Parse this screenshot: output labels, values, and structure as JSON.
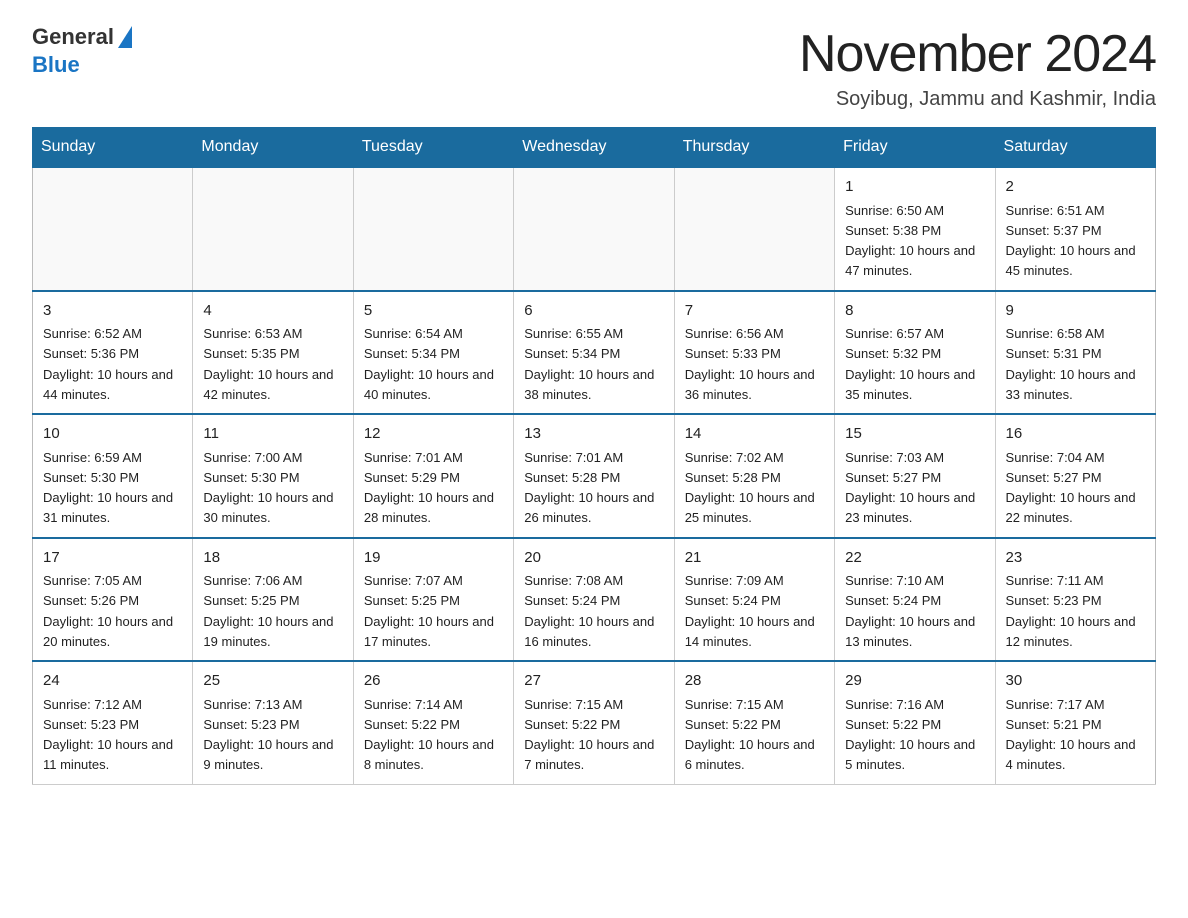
{
  "logo": {
    "general": "General",
    "blue": "Blue"
  },
  "header": {
    "month_year": "November 2024",
    "location": "Soyibug, Jammu and Kashmir, India"
  },
  "weekdays": [
    "Sunday",
    "Monday",
    "Tuesday",
    "Wednesday",
    "Thursday",
    "Friday",
    "Saturday"
  ],
  "weeks": [
    [
      {
        "day": "",
        "info": ""
      },
      {
        "day": "",
        "info": ""
      },
      {
        "day": "",
        "info": ""
      },
      {
        "day": "",
        "info": ""
      },
      {
        "day": "",
        "info": ""
      },
      {
        "day": "1",
        "info": "Sunrise: 6:50 AM\nSunset: 5:38 PM\nDaylight: 10 hours and 47 minutes."
      },
      {
        "day": "2",
        "info": "Sunrise: 6:51 AM\nSunset: 5:37 PM\nDaylight: 10 hours and 45 minutes."
      }
    ],
    [
      {
        "day": "3",
        "info": "Sunrise: 6:52 AM\nSunset: 5:36 PM\nDaylight: 10 hours and 44 minutes."
      },
      {
        "day": "4",
        "info": "Sunrise: 6:53 AM\nSunset: 5:35 PM\nDaylight: 10 hours and 42 minutes."
      },
      {
        "day": "5",
        "info": "Sunrise: 6:54 AM\nSunset: 5:34 PM\nDaylight: 10 hours and 40 minutes."
      },
      {
        "day": "6",
        "info": "Sunrise: 6:55 AM\nSunset: 5:34 PM\nDaylight: 10 hours and 38 minutes."
      },
      {
        "day": "7",
        "info": "Sunrise: 6:56 AM\nSunset: 5:33 PM\nDaylight: 10 hours and 36 minutes."
      },
      {
        "day": "8",
        "info": "Sunrise: 6:57 AM\nSunset: 5:32 PM\nDaylight: 10 hours and 35 minutes."
      },
      {
        "day": "9",
        "info": "Sunrise: 6:58 AM\nSunset: 5:31 PM\nDaylight: 10 hours and 33 minutes."
      }
    ],
    [
      {
        "day": "10",
        "info": "Sunrise: 6:59 AM\nSunset: 5:30 PM\nDaylight: 10 hours and 31 minutes."
      },
      {
        "day": "11",
        "info": "Sunrise: 7:00 AM\nSunset: 5:30 PM\nDaylight: 10 hours and 30 minutes."
      },
      {
        "day": "12",
        "info": "Sunrise: 7:01 AM\nSunset: 5:29 PM\nDaylight: 10 hours and 28 minutes."
      },
      {
        "day": "13",
        "info": "Sunrise: 7:01 AM\nSunset: 5:28 PM\nDaylight: 10 hours and 26 minutes."
      },
      {
        "day": "14",
        "info": "Sunrise: 7:02 AM\nSunset: 5:28 PM\nDaylight: 10 hours and 25 minutes."
      },
      {
        "day": "15",
        "info": "Sunrise: 7:03 AM\nSunset: 5:27 PM\nDaylight: 10 hours and 23 minutes."
      },
      {
        "day": "16",
        "info": "Sunrise: 7:04 AM\nSunset: 5:27 PM\nDaylight: 10 hours and 22 minutes."
      }
    ],
    [
      {
        "day": "17",
        "info": "Sunrise: 7:05 AM\nSunset: 5:26 PM\nDaylight: 10 hours and 20 minutes."
      },
      {
        "day": "18",
        "info": "Sunrise: 7:06 AM\nSunset: 5:25 PM\nDaylight: 10 hours and 19 minutes."
      },
      {
        "day": "19",
        "info": "Sunrise: 7:07 AM\nSunset: 5:25 PM\nDaylight: 10 hours and 17 minutes."
      },
      {
        "day": "20",
        "info": "Sunrise: 7:08 AM\nSunset: 5:24 PM\nDaylight: 10 hours and 16 minutes."
      },
      {
        "day": "21",
        "info": "Sunrise: 7:09 AM\nSunset: 5:24 PM\nDaylight: 10 hours and 14 minutes."
      },
      {
        "day": "22",
        "info": "Sunrise: 7:10 AM\nSunset: 5:24 PM\nDaylight: 10 hours and 13 minutes."
      },
      {
        "day": "23",
        "info": "Sunrise: 7:11 AM\nSunset: 5:23 PM\nDaylight: 10 hours and 12 minutes."
      }
    ],
    [
      {
        "day": "24",
        "info": "Sunrise: 7:12 AM\nSunset: 5:23 PM\nDaylight: 10 hours and 11 minutes."
      },
      {
        "day": "25",
        "info": "Sunrise: 7:13 AM\nSunset: 5:23 PM\nDaylight: 10 hours and 9 minutes."
      },
      {
        "day": "26",
        "info": "Sunrise: 7:14 AM\nSunset: 5:22 PM\nDaylight: 10 hours and 8 minutes."
      },
      {
        "day": "27",
        "info": "Sunrise: 7:15 AM\nSunset: 5:22 PM\nDaylight: 10 hours and 7 minutes."
      },
      {
        "day": "28",
        "info": "Sunrise: 7:15 AM\nSunset: 5:22 PM\nDaylight: 10 hours and 6 minutes."
      },
      {
        "day": "29",
        "info": "Sunrise: 7:16 AM\nSunset: 5:22 PM\nDaylight: 10 hours and 5 minutes."
      },
      {
        "day": "30",
        "info": "Sunrise: 7:17 AM\nSunset: 5:21 PM\nDaylight: 10 hours and 4 minutes."
      }
    ]
  ]
}
